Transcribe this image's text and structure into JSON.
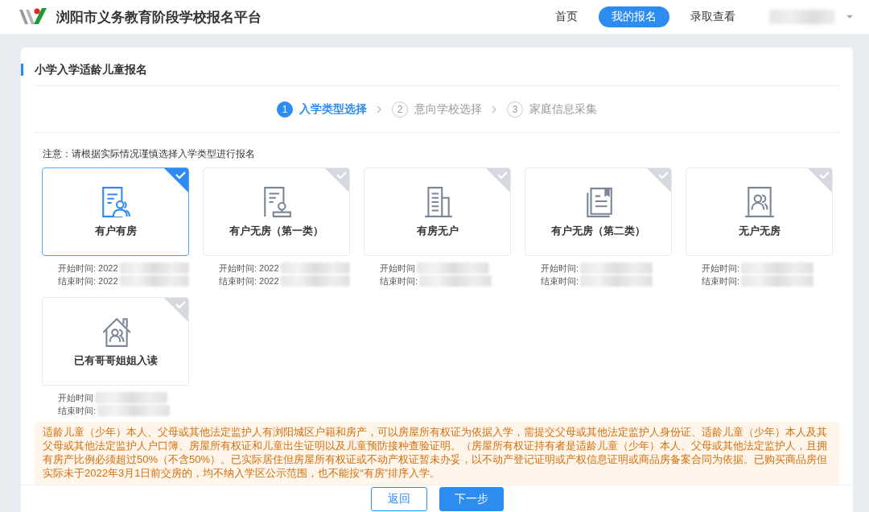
{
  "header": {
    "title": "浏阳市义务教育阶段学校报名平台",
    "nav": [
      {
        "label": "首页",
        "selected": false
      },
      {
        "label": "我的报名",
        "selected": true
      },
      {
        "label": "录取查看",
        "selected": false
      }
    ]
  },
  "page_title": "小学入学适龄儿童报名",
  "steps": [
    {
      "number": "1",
      "label": "入学类型选择",
      "current": true
    },
    {
      "number": "2",
      "label": "意向学校选择",
      "current": false
    },
    {
      "number": "3",
      "label": "家庭信息采集",
      "current": false
    }
  ],
  "note": "注意：请根据实际情况谨慎选择入学类型进行报名",
  "types": [
    {
      "label": "有户有房",
      "selected": true,
      "start": "开始时间: 2022",
      "end": "结束时间: 2022"
    },
    {
      "label": "有户无房（第一类）",
      "selected": false,
      "start": "开始时间: 2022",
      "end": "结束时间: 2022"
    },
    {
      "label": "有房无户",
      "selected": false,
      "start": "开始时间",
      "end": "结束时间:"
    },
    {
      "label": "有户无房（第二类）",
      "selected": false,
      "start": "开始时间:",
      "end": "结束时间:"
    },
    {
      "label": "无户无房",
      "selected": false,
      "start": "开始时间:",
      "end": "结束时间:"
    },
    {
      "label": "已有哥哥姐姐入读",
      "selected": false,
      "start": "开始时间",
      "end": "结束时间:"
    }
  ],
  "info": "适龄儿童（少年）本人、父母或其他法定监护人有浏阳城区户籍和房产，可以房屋所有权证为依据入学，需提交父母或其他法定监护人身份证、适龄儿童（少年）本人及其父母或其他法定监护人户口簿、房屋所有权证和儿童出生证明以及儿童预防接种查验证明。（房屋所有权证持有者是适龄儿童（少年）本人、父母或其他法定监护人，且拥有房产比例必须超过50%（不含50%）。已实际居住但房屋所有权证或不动产权证暂未办妥，以不动产登记证明或产权信息证明或商品房备案合同为依据。已购买商品房但实际未于2022年3月1日前交房的，均不纳入学区公示范围，也不能按“有房”排序入学。",
  "buttons": [
    {
      "label": "返回",
      "kind": "secondary"
    },
    {
      "label": "下一步",
      "kind": "primary"
    }
  ]
}
